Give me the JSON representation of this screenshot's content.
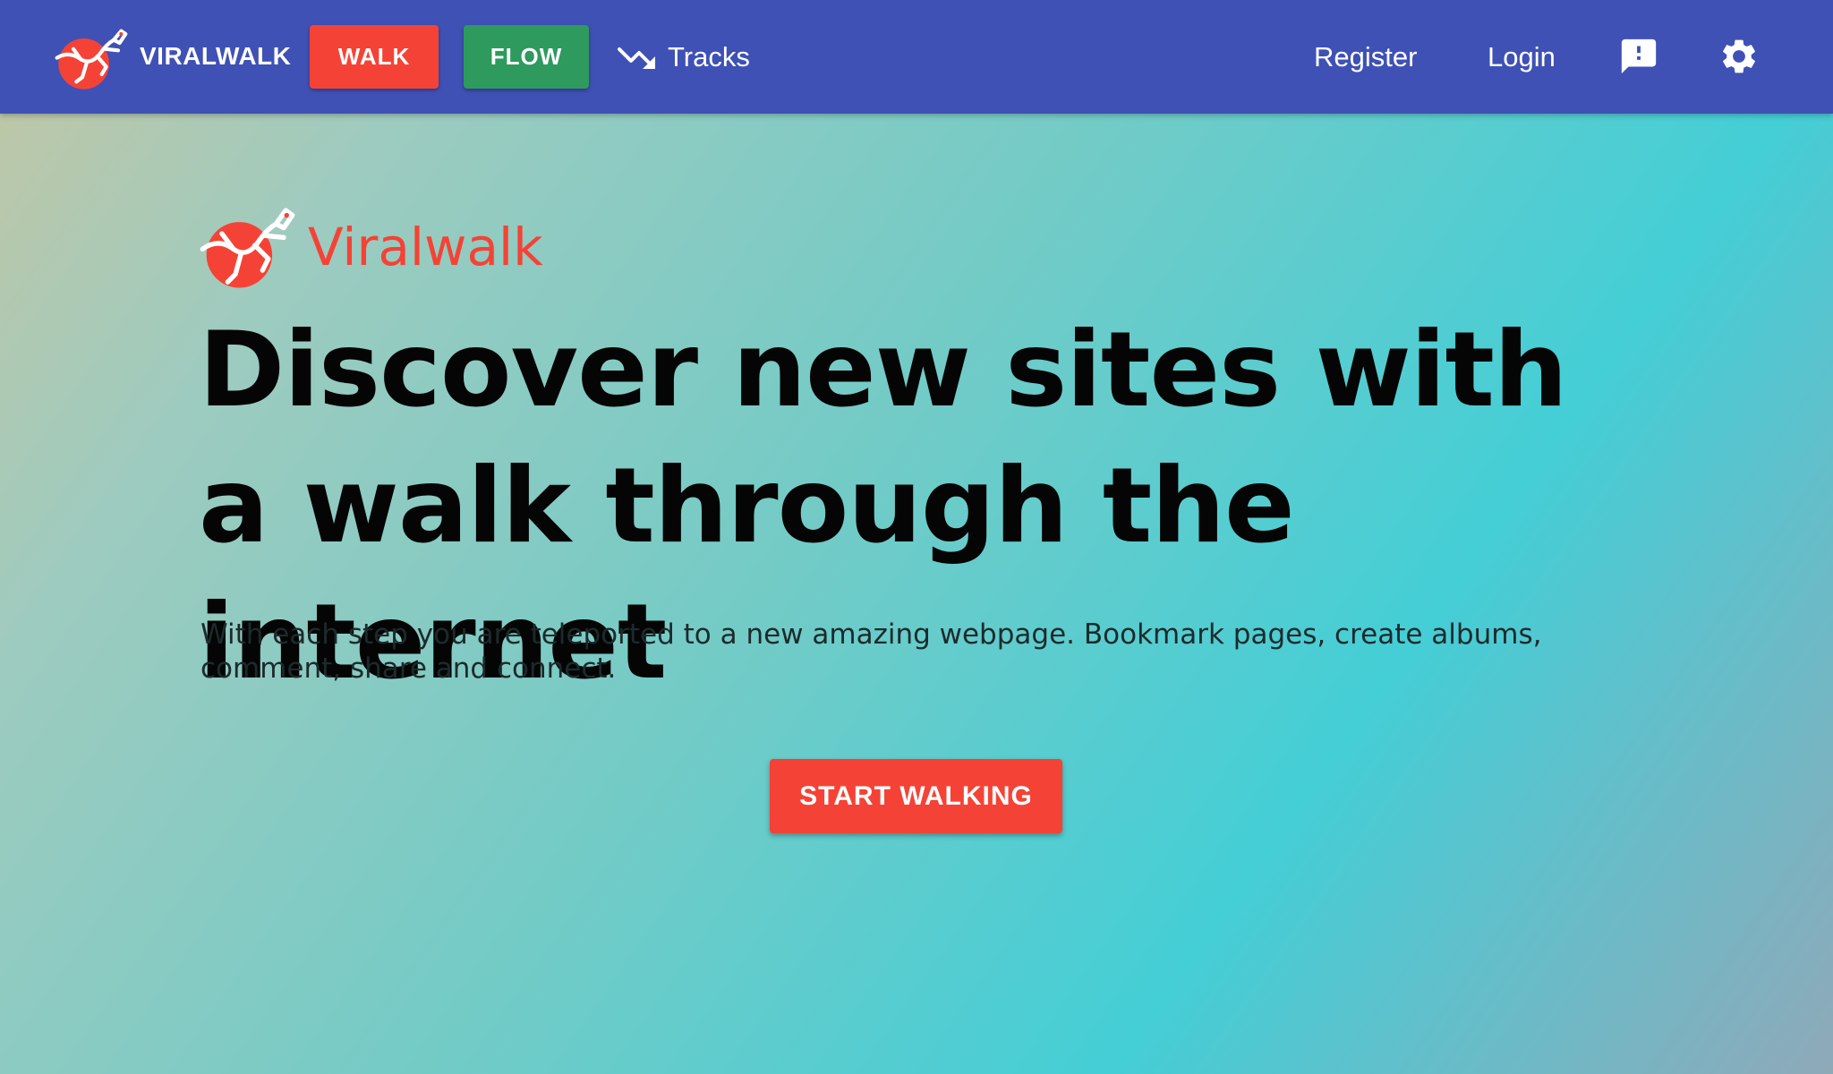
{
  "navbar": {
    "brand_name": "VIRALWALK",
    "brand_logo_icon": "gecko-logo-icon",
    "walk_label": "WALK",
    "flow_label": "FLOW",
    "tracks_label": "Tracks",
    "tracks_icon": "trending-down-icon",
    "register_label": "Register",
    "login_label": "Login",
    "feedback_icon": "feedback-icon",
    "settings_icon": "gear-icon"
  },
  "hero": {
    "logo_text": "Viralwalk",
    "headline": "Discover new sites with a walk through the internet",
    "subtitle": "With each step you are teleported to a new amazing webpage. Bookmark pages, create albums, comment, share and connect.",
    "cta_label": "START WALKING"
  },
  "colors": {
    "navbar": "#3f51b5",
    "walk_button": "#f44336",
    "flow_button": "#2e9a5e",
    "accent_red": "#f44336",
    "headline_text": "#050505"
  }
}
